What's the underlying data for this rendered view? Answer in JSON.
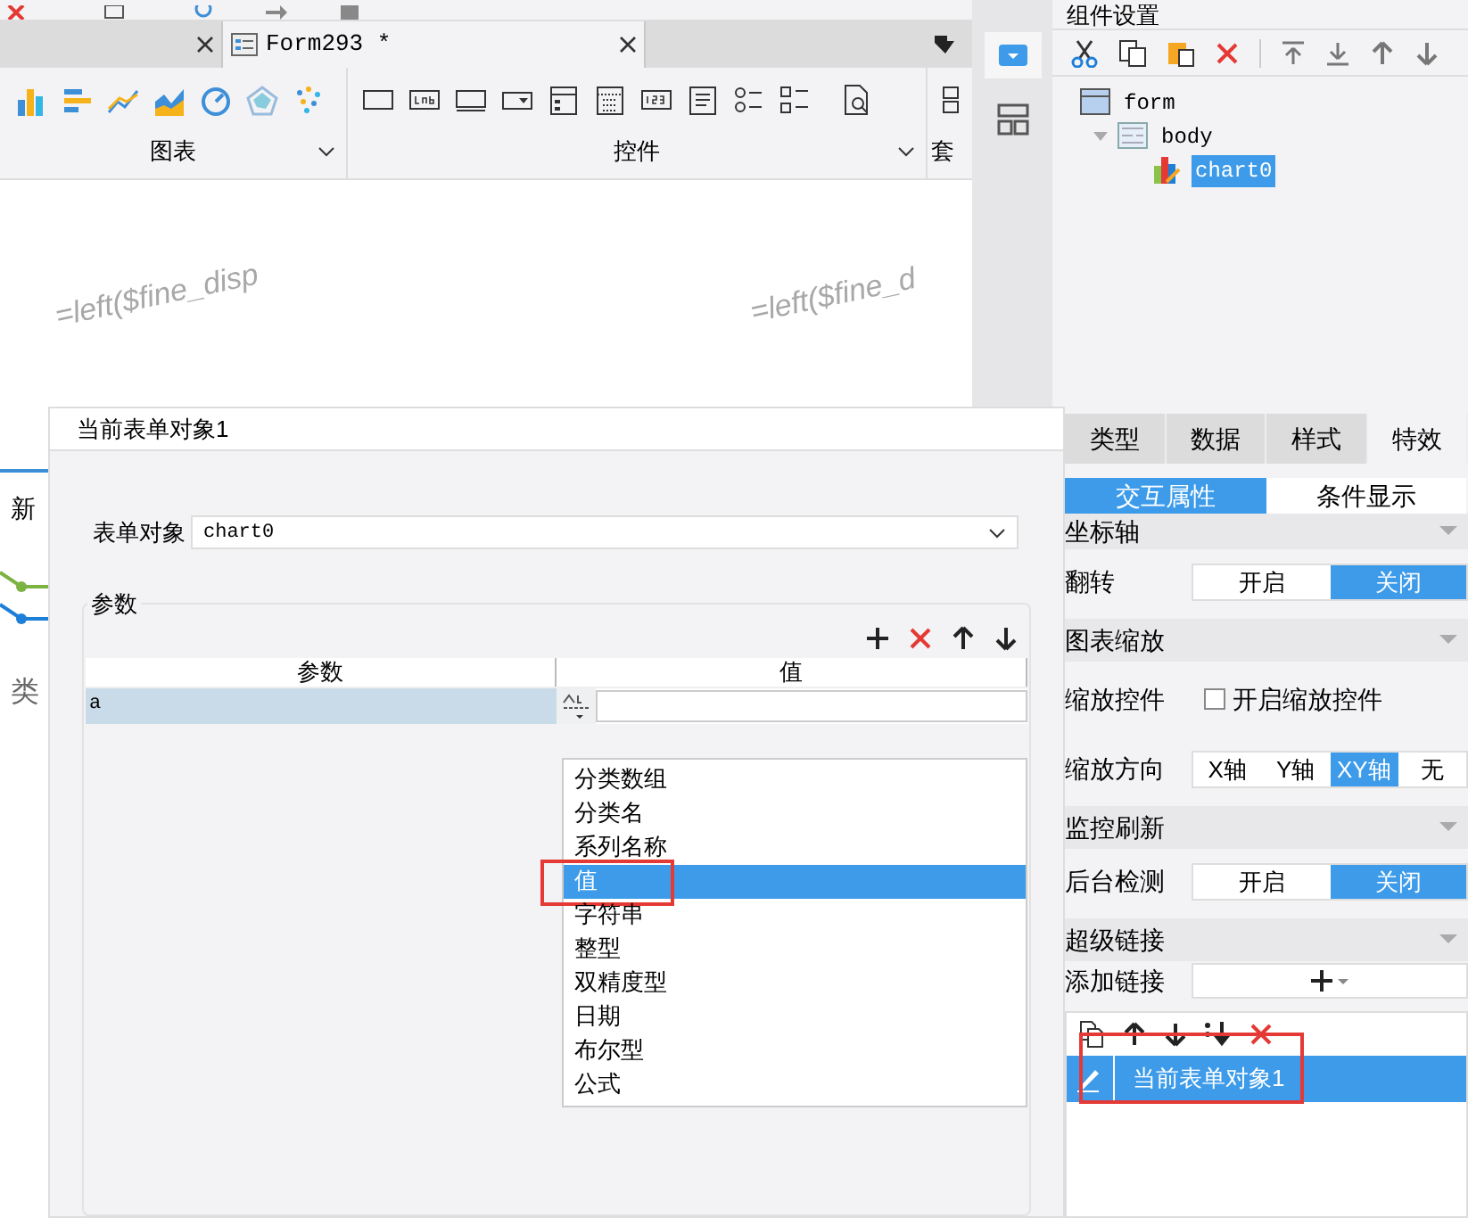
{
  "editor_tabs": [
    {
      "selected": false
    },
    {
      "label": "Form293 *",
      "selected": true
    }
  ],
  "ribbon_groups": [
    {
      "label": "图表"
    },
    {
      "label": "控件"
    },
    {
      "label": "套"
    }
  ],
  "canvas_texts": [
    "=left($fine_disp",
    "=left($fine_d"
  ],
  "background_panel": {
    "tab": "新",
    "label": "类"
  },
  "dialog": {
    "title": "当前表单对象1",
    "form_object_label": "表单对象",
    "form_object_value": "chart0",
    "params_legend": "参数",
    "columns": [
      "参数",
      "值"
    ],
    "rows": [
      {
        "name": "a",
        "selected": true
      }
    ],
    "type_menu": [
      {
        "label": "分类数组",
        "selected": false,
        "highlighted": false
      },
      {
        "label": "分类名",
        "selected": false,
        "highlighted": false
      },
      {
        "label": "系列名称",
        "selected": false,
        "highlighted": false
      },
      {
        "label": "值",
        "selected": true,
        "highlighted": true
      },
      {
        "label": "字符串",
        "selected": false,
        "highlighted": false
      },
      {
        "label": "整型",
        "selected": false,
        "highlighted": false
      },
      {
        "label": "双精度型",
        "selected": false,
        "highlighted": false
      },
      {
        "label": "日期",
        "selected": false,
        "highlighted": false
      },
      {
        "label": "布尔型",
        "selected": false,
        "highlighted": false
      },
      {
        "label": "公式",
        "selected": false,
        "highlighted": false
      }
    ]
  },
  "component_panel": {
    "title": "组件设置",
    "tree": [
      {
        "label": "form",
        "selected": false,
        "children": [
          {
            "label": "body",
            "selected": false,
            "children": [
              {
                "label": "chart0",
                "selected": true
              }
            ]
          }
        ]
      }
    ]
  },
  "property_tabs": [
    {
      "label": "类型",
      "selected": false
    },
    {
      "label": "数据",
      "selected": false
    },
    {
      "label": "样式",
      "selected": false
    },
    {
      "label": "特效",
      "selected": true
    }
  ],
  "sub_tabs": [
    {
      "label": "交互属性",
      "selected": true
    },
    {
      "label": "条件显示",
      "selected": false
    }
  ],
  "sections": [
    {
      "kind": "header",
      "label": "坐标轴"
    },
    {
      "kind": "toggle",
      "label": "翻转",
      "options": [
        {
          "label": "开启",
          "selected": false
        },
        {
          "label": "关闭",
          "selected": true
        }
      ]
    },
    {
      "kind": "header",
      "label": "图表缩放"
    },
    {
      "kind": "checkbox",
      "label": "缩放控件",
      "text": "开启缩放控件",
      "checked": false
    },
    {
      "kind": "toggle",
      "label": "缩放方向",
      "options": [
        {
          "label": "X轴",
          "selected": false
        },
        {
          "label": "Y轴",
          "selected": false
        },
        {
          "label": "XY轴",
          "selected": true
        },
        {
          "label": "无",
          "selected": false
        }
      ]
    },
    {
      "kind": "header",
      "label": "监控刷新"
    },
    {
      "kind": "toggle",
      "label": "后台检测",
      "options": [
        {
          "label": "开启",
          "selected": false
        },
        {
          "label": "关闭",
          "selected": true
        }
      ]
    },
    {
      "kind": "header",
      "label": "超级链接"
    },
    {
      "kind": "add",
      "label": "添加链接"
    }
  ],
  "links": [
    {
      "label": "当前表单对象1",
      "selected": true,
      "highlighted": true
    }
  ]
}
